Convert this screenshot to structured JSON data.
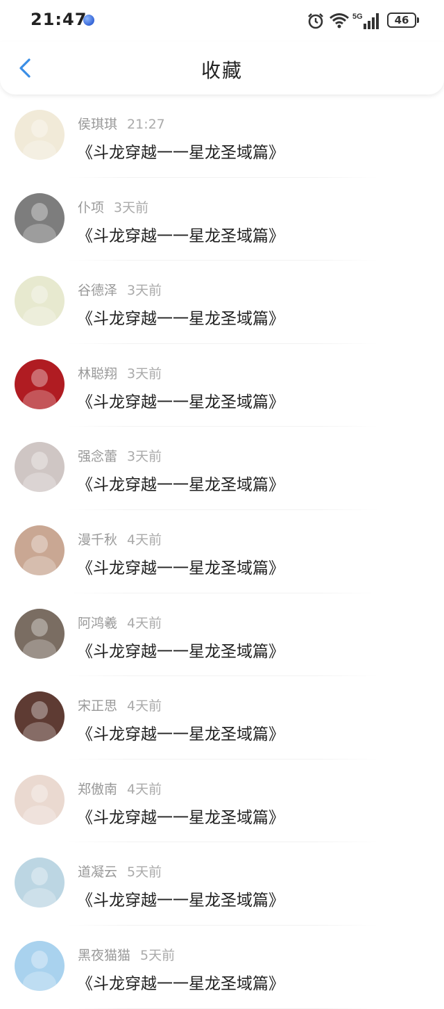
{
  "status_bar": {
    "time": "21:47",
    "signal_type": "5G",
    "battery": "46",
    "icons": [
      "alarm-icon",
      "wifi-icon",
      "signal-icon",
      "battery-icon"
    ]
  },
  "header": {
    "title": "收藏",
    "back_icon": "chevron-left-icon",
    "accent": "#3a8ee6"
  },
  "items": [
    {
      "name": "侯琪琪",
      "time": "21:27",
      "title": "《斗龙穿越一一星龙圣域篇》",
      "avatar_color": "#f1ead8"
    },
    {
      "name": "仆项",
      "time": "3天前",
      "title": "《斗龙穿越一一星龙圣域篇》",
      "avatar_color": "#7d7d7d"
    },
    {
      "name": "谷德泽",
      "time": "3天前",
      "title": "《斗龙穿越一一星龙圣域篇》",
      "avatar_color": "#e7e9cf"
    },
    {
      "name": "林聪翔",
      "time": "3天前",
      "title": "《斗龙穿越一一星龙圣域篇》",
      "avatar_color": "#b01c22"
    },
    {
      "name": "强念蕾",
      "time": "3天前",
      "title": "《斗龙穿越一一星龙圣域篇》",
      "avatar_color": "#cfc6c4"
    },
    {
      "name": "漫千秋",
      "time": "4天前",
      "title": "《斗龙穿越一一星龙圣域篇》",
      "avatar_color": "#c9a793"
    },
    {
      "name": "阿鸿羲",
      "time": "4天前",
      "title": "《斗龙穿越一一星龙圣域篇》",
      "avatar_color": "#7a6d62"
    },
    {
      "name": "宋正思",
      "time": "4天前",
      "title": "《斗龙穿越一一星龙圣域篇》",
      "avatar_color": "#5e3b33"
    },
    {
      "name": "郑傲南",
      "time": "4天前",
      "title": "《斗龙穿越一一星龙圣域篇》",
      "avatar_color": "#ead9d0"
    },
    {
      "name": "道凝云",
      "time": "5天前",
      "title": "《斗龙穿越一一星龙圣域篇》",
      "avatar_color": "#bcd6e3"
    },
    {
      "name": "黑夜猫猫",
      "time": "5天前",
      "title": "《斗龙穿越一一星龙圣域篇》",
      "avatar_color": "#a9d2ee"
    }
  ]
}
